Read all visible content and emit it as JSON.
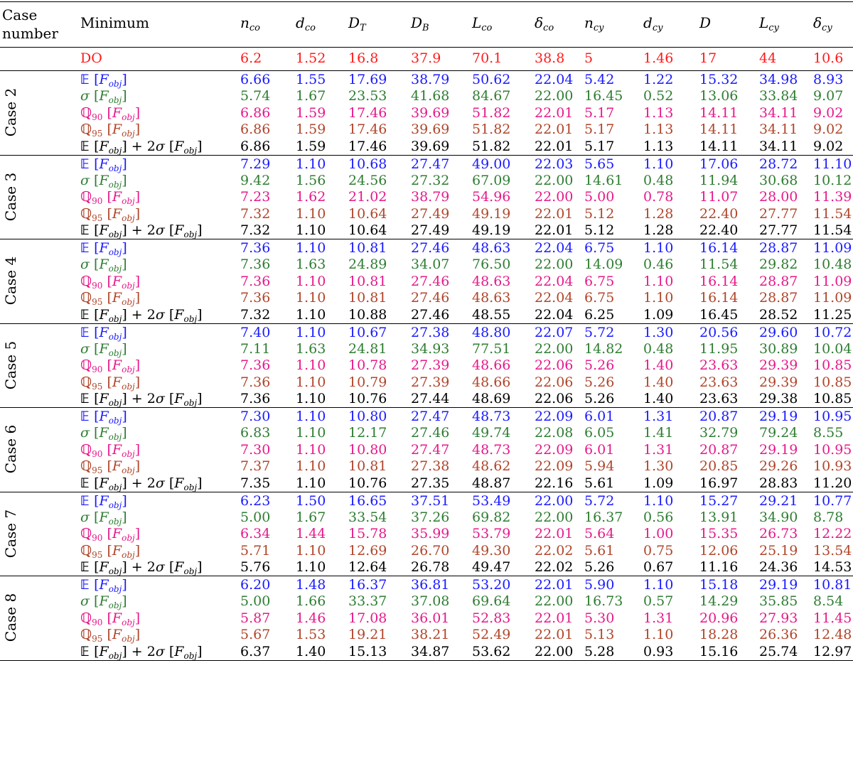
{
  "header": {
    "case_number": [
      "Case",
      "number"
    ],
    "minimum": "Minimum",
    "columns": [
      {
        "base": "n",
        "sub": "co"
      },
      {
        "base": "d",
        "sub": "co"
      },
      {
        "base": "D",
        "sub": "T"
      },
      {
        "base": "D",
        "sub": "B"
      },
      {
        "base": "L",
        "sub": "co"
      },
      {
        "base": "δ",
        "sub": "co"
      },
      {
        "base": "n",
        "sub": "cy"
      },
      {
        "base": "d",
        "sub": "cy"
      },
      {
        "base": "D",
        "sub": ""
      },
      {
        "base": "L",
        "sub": "cy"
      },
      {
        "base": "δ",
        "sub": "cy"
      }
    ]
  },
  "do_row": {
    "label": "DO",
    "values": [
      "6.2",
      "1.52",
      "16.8",
      "37.9",
      "70.1",
      "38.8",
      "5",
      "1.46",
      "17",
      "44",
      "10.6"
    ]
  },
  "row_kinds": [
    {
      "key": "mean",
      "color": "#1a1aff"
    },
    {
      "key": "std",
      "color": "#2e7d32"
    },
    {
      "key": "q90",
      "color": "#e6198a"
    },
    {
      "key": "q95",
      "color": "#b0452a"
    },
    {
      "key": "robust",
      "color": "#000000"
    }
  ],
  "colors": {
    "do": "#ff1a1a"
  },
  "cases": [
    {
      "name": "Case 2",
      "rows": [
        [
          "6.66",
          "1.55",
          "17.69",
          "38.79",
          "50.62",
          "22.04",
          "5.42",
          "1.22",
          "15.32",
          "34.98",
          "8.93"
        ],
        [
          "5.74",
          "1.67",
          "23.53",
          "41.68",
          "84.67",
          "22.00",
          "16.45",
          "0.52",
          "13.06",
          "33.84",
          "9.07"
        ],
        [
          "6.86",
          "1.59",
          "17.46",
          "39.69",
          "51.82",
          "22.01",
          "5.17",
          "1.13",
          "14.11",
          "34.11",
          "9.02"
        ],
        [
          "6.86",
          "1.59",
          "17.46",
          "39.69",
          "51.82",
          "22.01",
          "5.17",
          "1.13",
          "14.11",
          "34.11",
          "9.02"
        ],
        [
          "6.86",
          "1.59",
          "17.46",
          "39.69",
          "51.82",
          "22.01",
          "5.17",
          "1.13",
          "14.11",
          "34.11",
          "9.02"
        ]
      ]
    },
    {
      "name": "Case 3",
      "rows": [
        [
          "7.29",
          "1.10",
          "10.68",
          "27.47",
          "49.00",
          "22.03",
          "5.65",
          "1.10",
          "17.06",
          "28.72",
          "11.10"
        ],
        [
          "9.42",
          "1.56",
          "24.56",
          "27.32",
          "67.09",
          "22.00",
          "14.61",
          "0.48",
          "11.94",
          "30.68",
          "10.12"
        ],
        [
          "7.23",
          "1.62",
          "21.02",
          "38.79",
          "54.96",
          "22.00",
          "5.00",
          "0.78",
          "11.07",
          "28.00",
          "11.39"
        ],
        [
          "7.32",
          "1.10",
          "10.64",
          "27.49",
          "49.19",
          "22.01",
          "5.12",
          "1.28",
          "22.40",
          "27.77",
          "11.54"
        ],
        [
          "7.32",
          "1.10",
          "10.64",
          "27.49",
          "49.19",
          "22.01",
          "5.12",
          "1.28",
          "22.40",
          "27.77",
          "11.54"
        ]
      ]
    },
    {
      "name": "Case 4",
      "rows": [
        [
          "7.36",
          "1.10",
          "10.81",
          "27.46",
          "48.63",
          "22.04",
          "6.75",
          "1.10",
          "16.14",
          "28.87",
          "11.09"
        ],
        [
          "7.36",
          "1.63",
          "24.89",
          "34.07",
          "76.50",
          "22.00",
          "14.09",
          "0.46",
          "11.54",
          "29.82",
          "10.48"
        ],
        [
          "7.36",
          "1.10",
          "10.81",
          "27.46",
          "48.63",
          "22.04",
          "6.75",
          "1.10",
          "16.14",
          "28.87",
          "11.09"
        ],
        [
          "7.36",
          "1.10",
          "10.81",
          "27.46",
          "48.63",
          "22.04",
          "6.75",
          "1.10",
          "16.14",
          "28.87",
          "11.09"
        ],
        [
          "7.32",
          "1.10",
          "10.88",
          "27.46",
          "48.55",
          "22.04",
          "6.25",
          "1.09",
          "16.45",
          "28.52",
          "11.25"
        ]
      ]
    },
    {
      "name": "Case 5",
      "rows": [
        [
          "7.40",
          "1.10",
          "10.67",
          "27.38",
          "48.80",
          "22.07",
          "5.72",
          "1.30",
          "20.56",
          "29.60",
          "10.72"
        ],
        [
          "7.11",
          "1.63",
          "24.81",
          "34.93",
          "77.51",
          "22.00",
          "14.82",
          "0.48",
          "11.95",
          "30.89",
          "10.04"
        ],
        [
          "7.36",
          "1.10",
          "10.78",
          "27.39",
          "48.66",
          "22.06",
          "5.26",
          "1.40",
          "23.63",
          "29.39",
          "10.85"
        ],
        [
          "7.36",
          "1.10",
          "10.79",
          "27.39",
          "48.66",
          "22.06",
          "5.26",
          "1.40",
          "23.63",
          "29.39",
          "10.85"
        ],
        [
          "7.36",
          "1.10",
          "10.76",
          "27.44",
          "48.69",
          "22.06",
          "5.26",
          "1.40",
          "23.63",
          "29.38",
          "10.85"
        ]
      ]
    },
    {
      "name": "Case 6",
      "rows": [
        [
          "7.30",
          "1.10",
          "10.80",
          "27.47",
          "48.73",
          "22.09",
          "6.01",
          "1.31",
          "20.87",
          "29.19",
          "10.95"
        ],
        [
          "6.83",
          "1.10",
          "12.17",
          "27.46",
          "49.74",
          "22.08",
          "6.05",
          "1.41",
          "32.79",
          "79.24",
          "8.55"
        ],
        [
          "7.30",
          "1.10",
          "10.80",
          "27.47",
          "48.73",
          "22.09",
          "6.01",
          "1.31",
          "20.87",
          "29.19",
          "10.95"
        ],
        [
          "7.37",
          "1.10",
          "10.81",
          "27.38",
          "48.62",
          "22.09",
          "5.94",
          "1.30",
          "20.85",
          "29.26",
          "10.93"
        ],
        [
          "7.35",
          "1.10",
          "10.76",
          "27.35",
          "48.87",
          "22.16",
          "5.61",
          "1.09",
          "16.97",
          "28.83",
          "11.20"
        ]
      ]
    },
    {
      "name": "Case 7",
      "rows": [
        [
          "6.23",
          "1.50",
          "16.65",
          "37.51",
          "53.49",
          "22.00",
          "5.72",
          "1.10",
          "15.27",
          "29.21",
          "10.77"
        ],
        [
          "5.00",
          "1.67",
          "33.54",
          "37.26",
          "69.82",
          "22.00",
          "16.37",
          "0.56",
          "13.91",
          "34.90",
          "8.78"
        ],
        [
          "6.34",
          "1.44",
          "15.78",
          "35.99",
          "53.79",
          "22.01",
          "5.64",
          "1.00",
          "15.35",
          "26.73",
          "12.22"
        ],
        [
          "5.71",
          "1.10",
          "12.69",
          "26.70",
          "49.30",
          "22.02",
          "5.61",
          "0.75",
          "12.06",
          "25.19",
          "13.54"
        ],
        [
          "5.76",
          "1.10",
          "12.64",
          "26.78",
          "49.47",
          "22.02",
          "5.26",
          "0.67",
          "11.16",
          "24.36",
          "14.53"
        ]
      ]
    },
    {
      "name": "Case 8",
      "rows": [
        [
          "6.20",
          "1.48",
          "16.37",
          "36.81",
          "53.20",
          "22.01",
          "5.90",
          "1.10",
          "15.18",
          "29.19",
          "10.81"
        ],
        [
          "5.00",
          "1.66",
          "33.37",
          "37.08",
          "69.64",
          "22.00",
          "16.73",
          "0.57",
          "14.29",
          "35.85",
          "8.54"
        ],
        [
          "5.87",
          "1.46",
          "17.08",
          "36.01",
          "52.83",
          "22.01",
          "5.30",
          "1.31",
          "20.96",
          "27.93",
          "11.45"
        ],
        [
          "5.67",
          "1.53",
          "19.21",
          "38.21",
          "52.49",
          "22.01",
          "5.13",
          "1.10",
          "18.28",
          "26.36",
          "12.48"
        ],
        [
          "6.37",
          "1.40",
          "15.13",
          "34.87",
          "53.62",
          "22.00",
          "5.28",
          "0.93",
          "15.16",
          "25.74",
          "12.97"
        ]
      ]
    }
  ]
}
